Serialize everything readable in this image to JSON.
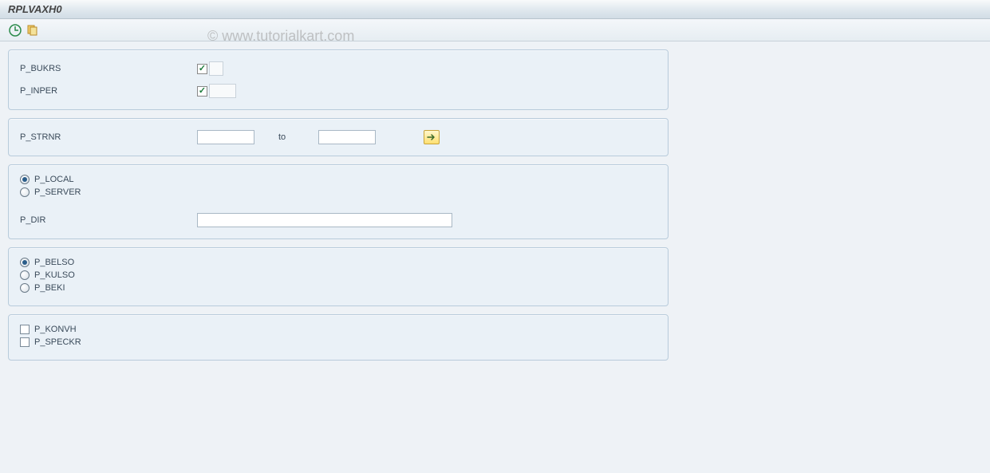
{
  "title": "RPLVAXH0",
  "watermark": "© www.tutorialkart.com",
  "toolbar": {
    "execute_icon": "execute",
    "variants_icon": "variants"
  },
  "group1": {
    "bukrs_label": "P_BUKRS",
    "bukrs_checked": true,
    "inper_label": "P_INPER",
    "inper_checked": true
  },
  "group2": {
    "strnr_label": "P_STRNR",
    "strnr_from": "",
    "to_label": "to",
    "strnr_to": ""
  },
  "group3": {
    "local_label": "P_LOCAL",
    "server_label": "P_SERVER",
    "dir_label": "P_DIR",
    "dir_value": "",
    "selected": "local"
  },
  "group4": {
    "belso_label": "P_BELSO",
    "kulso_label": "P_KULSO",
    "beki_label": "P_BEKI",
    "selected": "belso"
  },
  "group5": {
    "konvh_label": "P_KONVH",
    "konvh_checked": false,
    "speckr_label": "P_SPECKR",
    "speckr_checked": false
  }
}
